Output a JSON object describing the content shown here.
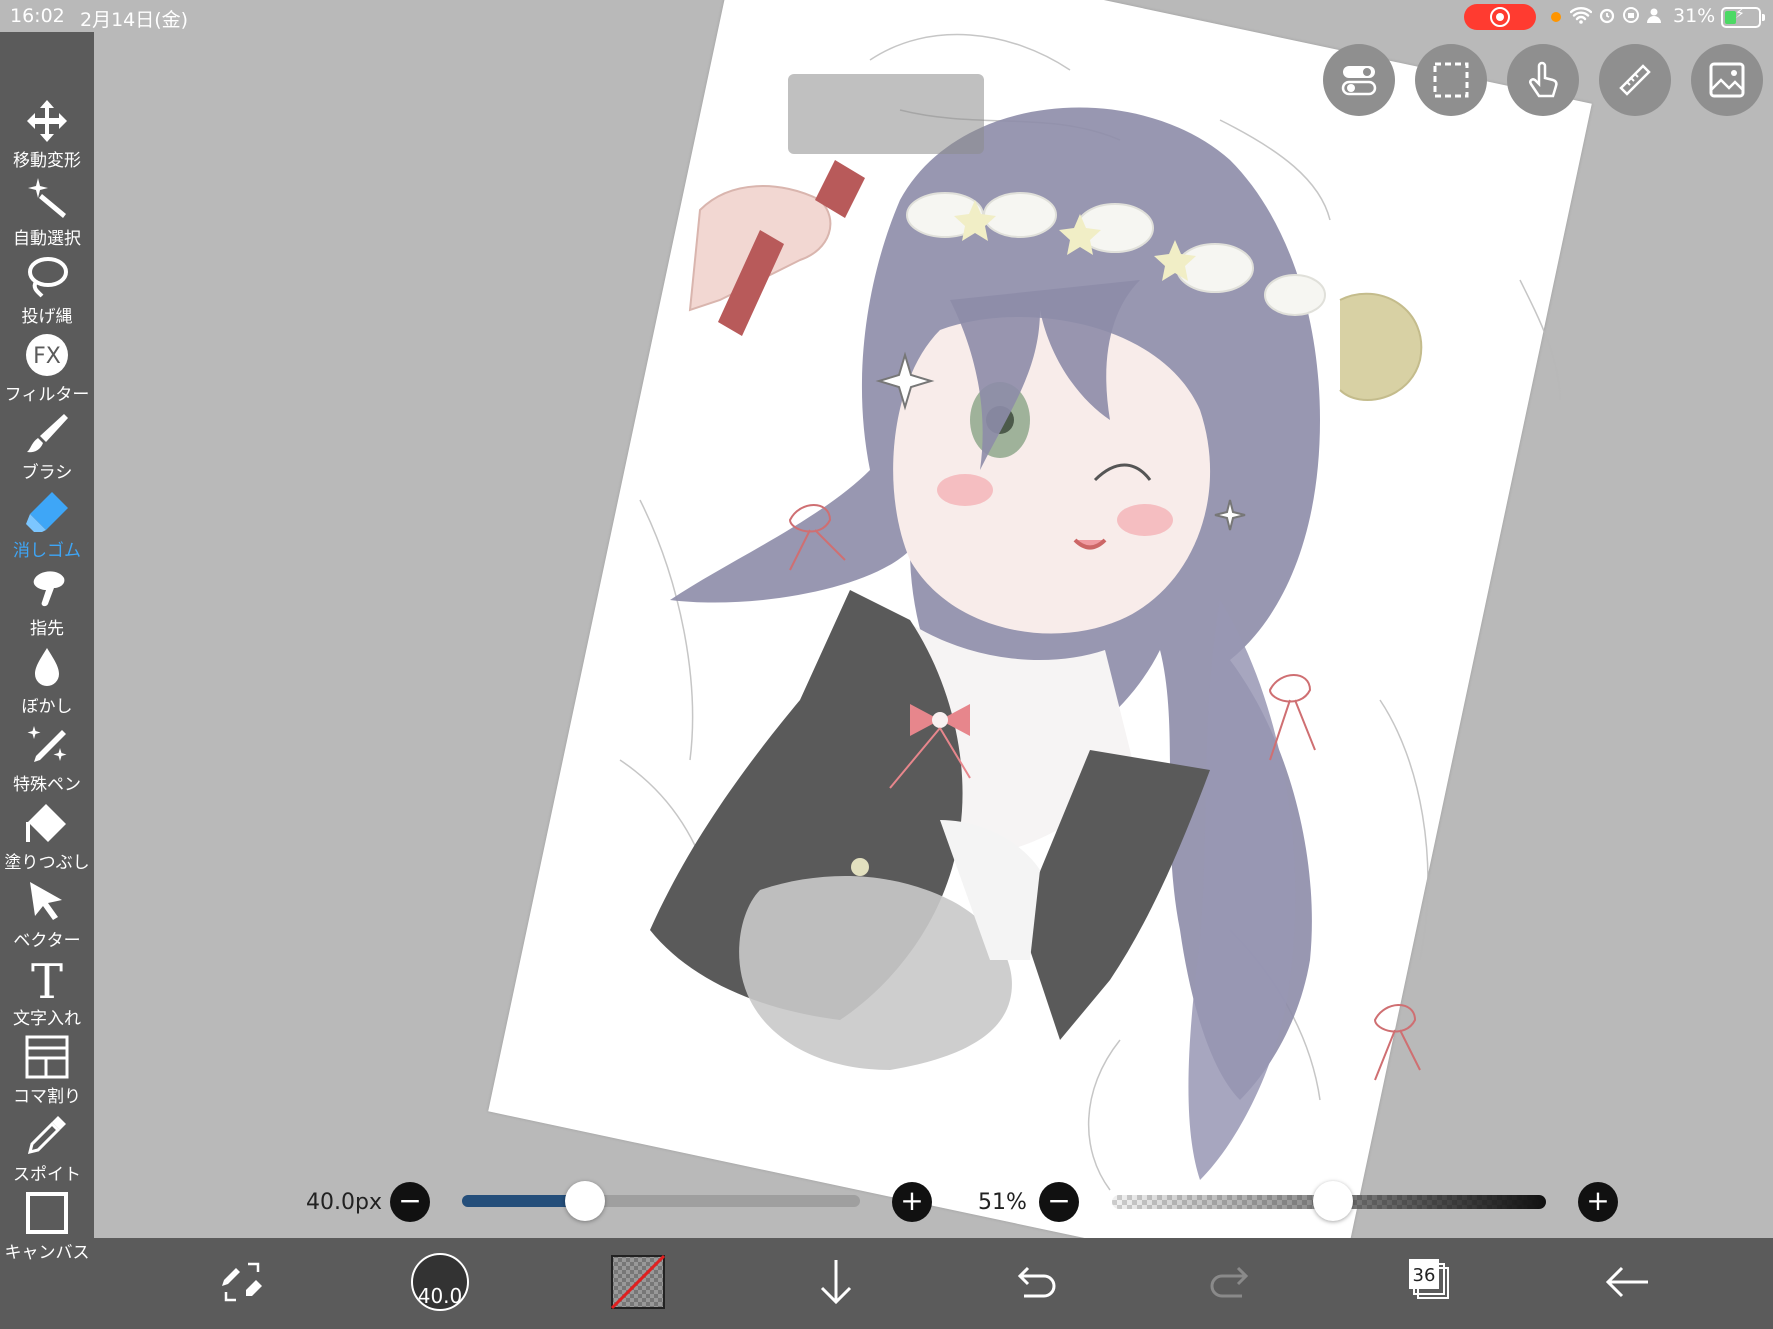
{
  "status_bar": {
    "time": "16:02",
    "date": "2月14日(金)",
    "battery_percent": "31%",
    "dots": "•••"
  },
  "tools": [
    {
      "label": "移動変形",
      "icon": "move-icon"
    },
    {
      "label": "自動選択",
      "icon": "magic-wand-icon"
    },
    {
      "label": "投げ縄",
      "icon": "lasso-icon"
    },
    {
      "label": "フィルター",
      "icon": "fx-icon",
      "glyph": "FX"
    },
    {
      "label": "ブラシ",
      "icon": "brush-icon"
    },
    {
      "label": "消しゴム",
      "icon": "eraser-icon",
      "active": true
    },
    {
      "label": "指先",
      "icon": "finger-icon"
    },
    {
      "label": "ぼかし",
      "icon": "blur-drop-icon"
    },
    {
      "label": "特殊ペン",
      "icon": "special-pen-icon"
    },
    {
      "label": "塗りつぶし",
      "icon": "fill-bucket-icon"
    },
    {
      "label": "ベクター",
      "icon": "vector-arrow-icon"
    },
    {
      "label": "文字入れ",
      "icon": "text-icon",
      "glyph": "T"
    },
    {
      "label": "コマ割り",
      "icon": "frame-divider-icon"
    },
    {
      "label": "スポイト",
      "icon": "eyedropper-icon"
    },
    {
      "label": "キャンバス",
      "icon": "canvas-icon"
    }
  ],
  "sliders": {
    "brush_size_label": "40.0px",
    "brush_size_fraction": 0.31,
    "opacity_label": "51%",
    "opacity_fraction": 0.51,
    "minus": "−",
    "plus": "+"
  },
  "bottom_bar": {
    "brush_size_badge": "40.0",
    "layer_count": "36"
  },
  "colors": {
    "toolbar_bg": "#5b5b5b",
    "workspace_bg": "#b9b9b9",
    "active_tool": "#3ea6f7",
    "size_fill": "#244e7a",
    "record_indicator": "#ff3b30"
  }
}
